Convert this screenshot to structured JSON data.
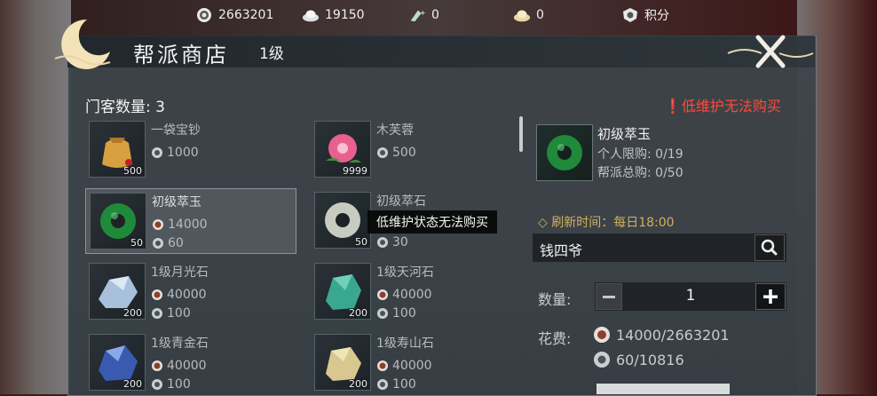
{
  "currencies": [
    {
      "icon": "coin-icon",
      "value": "2663201"
    },
    {
      "icon": "silver-ingot-icon",
      "value": "19150"
    },
    {
      "icon": "jade-plus-icon",
      "value": "0"
    },
    {
      "icon": "gold-ingot-icon",
      "value": "0"
    },
    {
      "icon": "points-icon",
      "value": "积分"
    }
  ],
  "window": {
    "title": "帮派商店",
    "level": "1级"
  },
  "members_label": "门客数量: 3",
  "warning": "低维护无法购买",
  "items": [
    {
      "name": "一袋宝钞",
      "prices": [
        "1000"
      ],
      "qty": "500"
    },
    {
      "name": "木芙蓉",
      "prices": [
        "500"
      ],
      "qty": "9999"
    },
    {
      "name": "初级萃玉",
      "prices": [
        "14000",
        "60"
      ],
      "qty": "50"
    },
    {
      "name": "初级萃石",
      "prices": [
        "",
        "30"
      ],
      "qty": "50"
    },
    {
      "name": "1级月光石",
      "prices": [
        "40000",
        "100"
      ],
      "qty": "200"
    },
    {
      "name": "1级天河石",
      "prices": [
        "40000",
        "100"
      ],
      "qty": "200"
    },
    {
      "name": "1级青金石",
      "prices": [
        "40000",
        "100"
      ],
      "qty": "200"
    },
    {
      "name": "1级寿山石",
      "prices": [
        "40000",
        "100"
      ],
      "qty": "200"
    }
  ],
  "tooltip": "低维护状态无法购买",
  "detail": {
    "name": "初级萃玉",
    "personal_limit": "个人限购:  0/19",
    "guild_limit": "帮派总购:  0/50",
    "refresh": "◇ 刷新时间：每日18:00",
    "merchant": "钱四爷",
    "quantity_label": "数量:",
    "quantity": "1",
    "cost_label": "花费:",
    "cost_coin": "14000/2663201",
    "cost_point": "60/10816"
  }
}
